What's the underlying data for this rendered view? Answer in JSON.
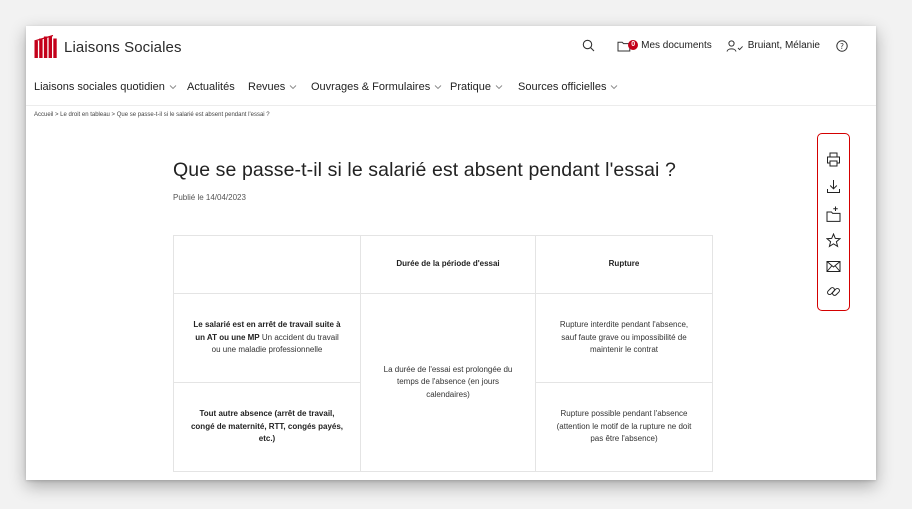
{
  "brand": {
    "name": "Liaisons Sociales",
    "accent": "#c4001a"
  },
  "header": {
    "search_icon": "search-icon",
    "documents": {
      "label": "Mes documents",
      "count": "0"
    },
    "user": {
      "label": "Bruiant, Mélanie"
    },
    "help_icon": "help-icon"
  },
  "nav": {
    "items": [
      {
        "label": "Liaisons sociales quotidien",
        "dropdown": true
      },
      {
        "label": "Actualités",
        "dropdown": false
      },
      {
        "label": "Revues",
        "dropdown": true
      },
      {
        "label": "Ouvrages & Formulaires",
        "dropdown": true
      },
      {
        "label": "Pratique",
        "dropdown": true
      },
      {
        "label": "Sources officielles",
        "dropdown": true
      }
    ]
  },
  "breadcrumb": "Accueil > Le droit en tableau > Que se passe-t-il si le salarié est absent pendant l'essai ?",
  "article": {
    "title": "Que se passe-t-il si le salarié est absent pendant l'essai ?",
    "published": "Publié le 14/04/2023"
  },
  "table": {
    "headers": [
      "",
      "Durée de la période d'essai",
      "Rupture"
    ],
    "rows": [
      {
        "label_bold": "Le salarié est en arrêt de travail suite à un AT ou une MP",
        "label_rest": " Un accident du travail ou une maladie professionnelle",
        "rupture": "Rupture interdite pendant l'absence, sauf faute grave ou impossibilité de maintenir le contrat"
      },
      {
        "label_bold": "Tout autre absence (arrêt de travail, congé de maternité, RTT, congés payés, etc.)",
        "label_rest": "",
        "rupture": "Rupture possible pendant l'absence (attention le motif de la rupture ne doit pas être l'absence)"
      }
    ],
    "shared_duree": "La durée de l'essai est prolongée du temps de l'absence (en jours calendaires)"
  },
  "toolbar": {
    "highlight_color": "#d40000",
    "tools": [
      "print-icon",
      "download-icon",
      "add-to-folder-icon",
      "favorite-star-icon",
      "email-icon",
      "link-icon"
    ]
  }
}
